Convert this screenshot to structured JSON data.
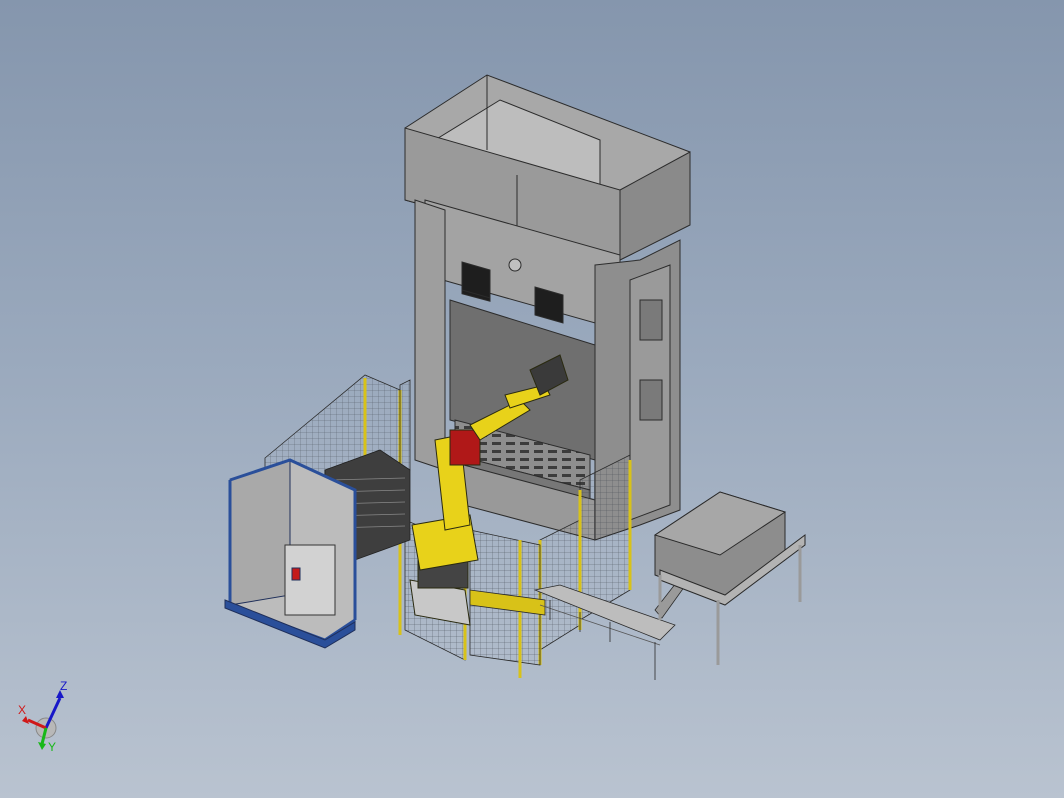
{
  "triad": {
    "x_label": "X",
    "y_label": "Y",
    "z_label": "Z",
    "colors": {
      "x": "#d01818",
      "y": "#18b818",
      "z": "#1818c8"
    }
  },
  "colors": {
    "background_top": "#8596ad",
    "background_bottom": "#b9c3d0",
    "press_body": "#9c9c9c",
    "robot": "#e8d21a",
    "fence_frame": "#d8c218",
    "cabinet_frame": "#2a4f9a"
  }
}
